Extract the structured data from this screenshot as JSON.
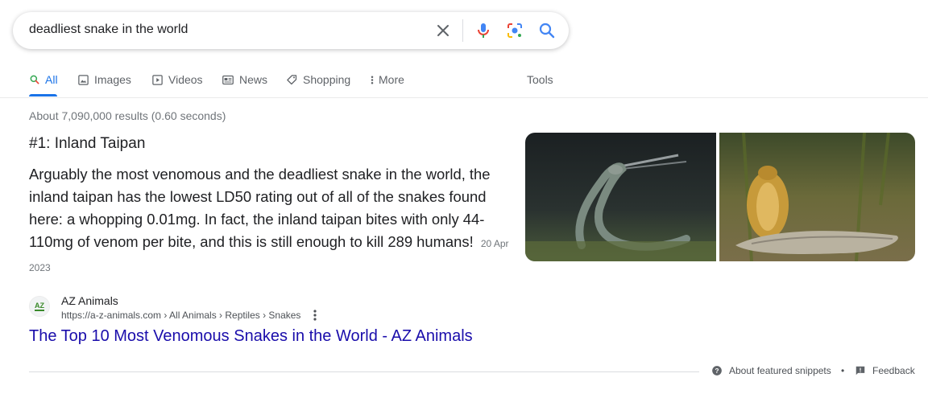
{
  "search": {
    "query": "deadliest snake in the world"
  },
  "icons": {
    "clear": "close-icon",
    "voice": "microphone-icon",
    "lens": "camera-lens-icon",
    "search": "search-icon"
  },
  "tabs": [
    {
      "label": "All",
      "icon": "search-icon",
      "active": true
    },
    {
      "label": "Images",
      "icon": "image-icon"
    },
    {
      "label": "Videos",
      "icon": "play-icon"
    },
    {
      "label": "News",
      "icon": "newspaper-icon"
    },
    {
      "label": "Shopping",
      "icon": "tag-icon"
    },
    {
      "label": "More",
      "icon": "more-vert-icon"
    }
  ],
  "tools_label": "Tools",
  "result_stats": "About 7,090,000 results (0.60 seconds)",
  "featured_snippet": {
    "heading": "#1: Inland Taipan",
    "body": "Arguably the most venomous and the deadliest snake in the world, the inland taipan has the lowest LD50 rating out of all of the snakes found here: a whopping 0.01mg. In fact, the inland taipan bites with only 44-110mg of venom per bite, and this is still enough to kill 289 humans!",
    "date": "20 Apr 2023"
  },
  "source": {
    "name": "AZ Animals",
    "url": "https://a-z-animals.com › All Animals › Reptiles › Snakes",
    "title": "The Top 10 Most Venomous Snakes in the World - AZ Animals",
    "favicon_text": "AZ"
  },
  "footer": {
    "about": "About featured snippets",
    "separator": "•",
    "feedback": "Feedback"
  },
  "colors": {
    "accent": "#1a73e8",
    "link": "#1a0dab",
    "muted": "#70757a"
  }
}
